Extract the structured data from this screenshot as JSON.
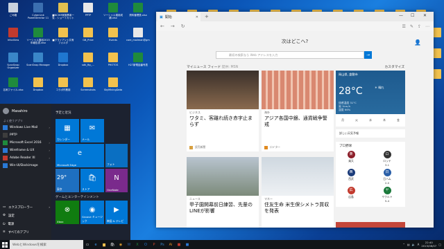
{
  "desktop": {
    "icons": [
      {
        "label": "ごみ箱",
        "color": "#c9d2de"
      },
      {
        "label": "CyberLink PowerDirector 11",
        "color": "#3b6fb0"
      },
      {
        "label": "■NCHM実施業者一覧 - ショートカット",
        "color": "#e0c050"
      },
      {
        "label": "PPTP",
        "color": "#e8e8e8"
      },
      {
        "label": "ソーシャル運用成績.xlsx",
        "color": "#1f8a3c"
      },
      {
        "label": "資料管理表.xlsx",
        "color": "#1f8a3c"
      },
      {
        "label": "IrfanView",
        "color": "#c23a2e"
      },
      {
        "label": "ソーシャル運用2015年報告書.xlsx",
        "color": "#1f8a3c"
      },
      {
        "label": "■クライアント共有フォルダ",
        "color": "#f2c24e"
      },
      {
        "label": "GB_Price",
        "color": "#f2c24e"
      },
      {
        "label": "Events",
        "color": "#f2c24e"
      },
      {
        "label": "core_mailman@gmail...",
        "color": "#e8e8e8"
      },
      {
        "label": "ScanSnap Organizer",
        "color": "#3a86c8"
      },
      {
        "label": "ScanSnap Manager",
        "color": "#3a86c8"
      },
      {
        "label": "Dropbox",
        "color": "#1f77d0"
      },
      {
        "label": "sdk_ftp_...",
        "color": "#f2c24e"
      },
      {
        "label": "PHOTOS",
        "color": "#f2c24e"
      },
      {
        "label": "H27新電話番号表",
        "color": "#1f8a3c"
      },
      {
        "label": "名刺ファイル.xlsx",
        "color": "#1f8a3c"
      },
      {
        "label": "Dropbox",
        "color": "#f2c24e"
      },
      {
        "label": "コラボ作業用",
        "color": "#f2c24e"
      },
      {
        "label": "Screenshots",
        "color": "#f2c24e"
      },
      {
        "label": "SkyMiningData",
        "color": "#f2c24e"
      }
    ]
  },
  "start_menu": {
    "user_name": "Masahiro",
    "frequent_header": "よく使うアプリ",
    "apps": [
      {
        "label": "Windows Live Mail",
        "color": "#2a79d6",
        "arrow": "›"
      },
      {
        "label": "PPTP",
        "color": "#3d3d3d",
        "arrow": ""
      },
      {
        "label": "Microsoft Excel 2016",
        "color": "#1f8a3c",
        "arrow": "›"
      },
      {
        "label": "Wireframe & UX",
        "color": "#2a79d6",
        "arrow": "›"
      },
      {
        "label": "Adobe Reader XI",
        "color": "#c23a2e",
        "arrow": "›"
      },
      {
        "label": "Win-UI/Dockimage",
        "color": "#2a79d6",
        "arrow": ""
      }
    ],
    "system": [
      {
        "label": "エクスプローラー",
        "glyph": "▭",
        "arrow": "›"
      },
      {
        "label": "設定",
        "glyph": "⚙",
        "arrow": ""
      },
      {
        "label": "電源",
        "glyph": "⏻",
        "arrow": ""
      },
      {
        "label": "すべてのアプリ",
        "glyph": "≡",
        "arrow": ""
      }
    ],
    "group1": "予定と近況",
    "group2": "ゲームとエンターテインメント",
    "tiles": {
      "calendar": "カレンダー",
      "mail": "メール",
      "edge": "Microsoft Edge",
      "photos": "フォト",
      "weather_temp": "29°",
      "weather_city": "東京",
      "store": "ストア",
      "onenote": "OneNote",
      "xbox": "Xbox",
      "groove": "Groove ミュージック",
      "movies": "映画 & テレビ"
    }
  },
  "browser": {
    "tab_title": "開始",
    "new_tab": "+",
    "window_controls": [
      "—",
      "☐",
      "✕"
    ],
    "page": {
      "heading": "次はどこへ?",
      "search_placeholder": "最初の検索なら Web アドレスを入力",
      "search_button": "→",
      "feed_header": "マイニュース フィード",
      "feed_sub": "提供: MSN",
      "customize": "カスタマイズ",
      "cards": [
        {
          "cat": "ビジネス",
          "title": "ワタミ、客離れ続き赤字止まらず",
          "source": "読売新聞",
          "img": "#6a5a4e"
        },
        {
          "cat": "海外",
          "title": "アジア各国中銀、通貨戦争警戒",
          "source": "ロイター",
          "img": "#c77b6a"
        },
        {
          "cat": "ニュース",
          "title": "甲子園開幕前日練習、先輩のLINEが影響",
          "source": "",
          "img": "#9aa7b3"
        },
        {
          "cat": "マネー",
          "title": "住友生命 米生保シメトラ買収を発表",
          "source": "",
          "img": "#d6dde4"
        }
      ],
      "weather": {
        "location": "岡山県, 倉敷市",
        "temp": "28°C",
        "condition": "晴れ",
        "details": "体感温度 31°C\n風 1km/h\n湿度 66%",
        "days": [
          "月",
          "火",
          "水",
          "木",
          "金"
        ],
        "link": "詳しい天気予報"
      },
      "baseball": {
        "header": "プロ野球",
        "teams": [
          {
            "name": "楽天",
            "score": "",
            "letter": "楽",
            "color": "#8c1f2a"
          },
          {
            "name": "ロッテ",
            "score": "3-1",
            "letter": "ロ",
            "color": "#333"
          },
          {
            "name": "西武",
            "score": "",
            "letter": "西",
            "color": "#1c3c7a"
          },
          {
            "name": "日ハム",
            "score": "2-0",
            "letter": "日",
            "color": "#2a5fa8"
          },
          {
            "name": "広島",
            "score": "",
            "letter": "広",
            "color": "#c23a2e"
          },
          {
            "name": "ヤクルト",
            "score": "5-4",
            "letter": "ヤ",
            "color": "#1c7a3c"
          }
        ]
      }
    }
  },
  "taskbar": {
    "search_placeholder": "WebとWindowsを検索",
    "time": "22:40",
    "date": "2015/08/07",
    "ime": "A"
  }
}
